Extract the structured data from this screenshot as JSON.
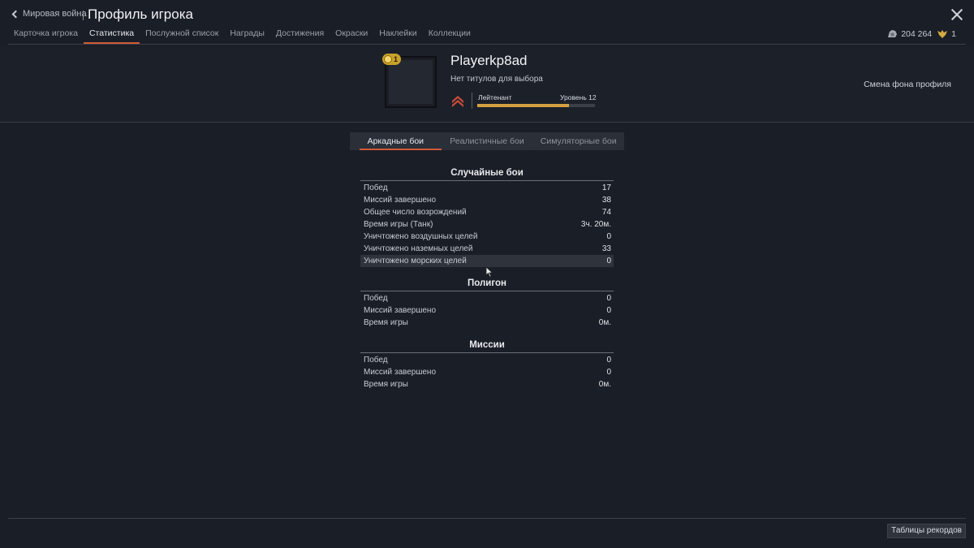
{
  "header": {
    "back_label": "Мировая война",
    "title": "Профиль игрока",
    "tabs": [
      {
        "label": "Карточка игрока",
        "active": false
      },
      {
        "label": "Статистика",
        "active": true
      },
      {
        "label": "Послужной список",
        "active": false
      },
      {
        "label": "Награды",
        "active": false
      },
      {
        "label": "Достижения",
        "active": false
      },
      {
        "label": "Окраски",
        "active": false
      },
      {
        "label": "Наклейки",
        "active": false
      },
      {
        "label": "Коллекции",
        "active": false
      }
    ],
    "silver_lions": "204 264",
    "golden_eagles": "1"
  },
  "profile": {
    "badge_count": "1",
    "player_name": "Playerkp8ad",
    "titles_note": "Нет титулов для выбора",
    "rank": "Лейтенант",
    "level_label": "Уровень 12",
    "xp_progress": 0.78,
    "change_background": "Смена фона профиля"
  },
  "modes": [
    {
      "label": "Аркадные бои",
      "active": true
    },
    {
      "label": "Реалистичные бои",
      "active": false
    },
    {
      "label": "Симуляторные бои",
      "active": false
    }
  ],
  "sections": {
    "random": {
      "title": "Случайные бои",
      "rows": [
        {
          "label": "Побед",
          "value": "17"
        },
        {
          "label": "Миссий завершено",
          "value": "38"
        },
        {
          "label": "Общее число возрождений",
          "value": "74"
        },
        {
          "label": "Время игры (Танк)",
          "value": "3ч. 20м."
        },
        {
          "label": "Уничтожено воздушных целей",
          "value": "0"
        },
        {
          "label": "Уничтожено наземных целей",
          "value": "33"
        },
        {
          "label": "Уничтожено морских целей",
          "value": "0"
        }
      ]
    },
    "polygon": {
      "title": "Полигон",
      "rows": [
        {
          "label": "Побед",
          "value": "0"
        },
        {
          "label": "Миссий завершено",
          "value": "0"
        },
        {
          "label": "Время игры",
          "value": "0м."
        }
      ]
    },
    "missions": {
      "title": "Миссии",
      "rows": [
        {
          "label": "Побед",
          "value": "0"
        },
        {
          "label": "Миссий завершено",
          "value": "0"
        },
        {
          "label": "Время игры",
          "value": "0м."
        }
      ]
    }
  },
  "footer": {
    "leaderboards": "Таблицы рекордов"
  },
  "colors": {
    "accent": "#d05a3a",
    "background": "#1a1e26",
    "xp_fill": "#d4a040"
  }
}
